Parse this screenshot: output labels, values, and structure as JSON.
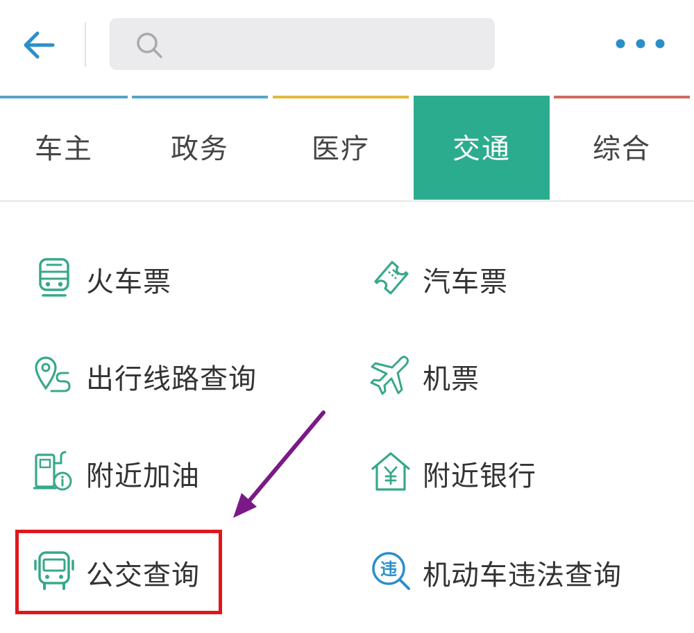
{
  "header": {
    "search": {
      "placeholder": ""
    }
  },
  "tabs": [
    {
      "label": "车主",
      "bar_color": "#5aa3c8",
      "active": false
    },
    {
      "label": "政务",
      "bar_color": "#5aa3c8",
      "active": false
    },
    {
      "label": "医疗",
      "bar_color": "#e4b93e",
      "active": false
    },
    {
      "label": "交通",
      "bar_color": "#2cac8e",
      "active": true
    },
    {
      "label": "综合",
      "bar_color": "#d06a5e",
      "active": false
    }
  ],
  "services": [
    {
      "label": "火车票",
      "icon": "train-icon"
    },
    {
      "label": "汽车票",
      "icon": "ticket-icon"
    },
    {
      "label": "出行线路查询",
      "icon": "route-pin-icon"
    },
    {
      "label": "机票",
      "icon": "plane-icon"
    },
    {
      "label": "附近加油",
      "icon": "gas-station-icon"
    },
    {
      "label": "附近银行",
      "icon": "bank-icon"
    },
    {
      "label": "公交查询",
      "icon": "bus-icon"
    },
    {
      "label": "机动车违法查询",
      "icon": "violation-search-icon"
    }
  ],
  "colors": {
    "accent": "#2cac8e",
    "icon_green": "#37a88a",
    "icon_blue": "#2a8fc9",
    "highlight_red": "#e0161b",
    "annotation_arrow": "#7a1a86"
  }
}
